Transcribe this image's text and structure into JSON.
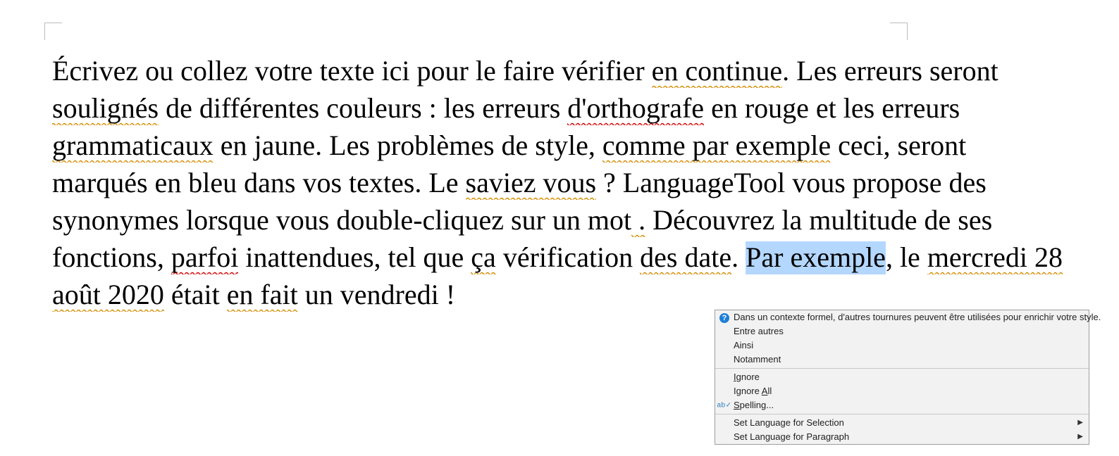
{
  "text": {
    "t0": "Écrivez ou collez votre texte ici pour le faire vérifier ",
    "e0": "en continue",
    "t1": ". Les erreurs seront ",
    "e1": "soulignés",
    "t2": " de différentes couleurs : les erreurs ",
    "e2": "d'orthografe",
    "t3": " en rouge et les erreurs ",
    "e3": "grammaticaux",
    "t4": " en jaune. Les problèmes de style, ",
    "e4": "comme par exemple",
    "t5": " ceci, seront marqués en bleu dans vos textes. Le ",
    "e5": "saviez vous",
    "t6": " ? LanguageTool vous propose des synonymes lorsque vous double-cliquez sur un mot",
    "e6": " .",
    "t7": " Découvrez la multitude de ses fonctions, ",
    "e7": "parfoi",
    "t8": " inattendues, tel que ",
    "e8": "ça",
    "t9": " vérification ",
    "e9": "des date",
    "t10": ". ",
    "sel": "Par exemple",
    "t11": ", le ",
    "e10": "mercredi 28 août 2020",
    "t12": " était ",
    "e11": "en fait",
    "t13": " un vendredi !"
  },
  "menu": {
    "explain": "Dans un contexte formel, d'autres tournures peuvent être utilisées pour enrichir votre style.",
    "sugg": [
      "Entre autres",
      "Ainsi",
      "Notamment"
    ],
    "ignore_char": "I",
    "ignore_rest": "gnore",
    "ignoreall_pre": "Ignore ",
    "ignoreall_char": "A",
    "ignoreall_rest": "ll",
    "spelling_char": "S",
    "spelling_rest": "pelling...",
    "setlang_sel": "Set Language for Selection",
    "setlang_par": "Set Language for Paragraph"
  }
}
